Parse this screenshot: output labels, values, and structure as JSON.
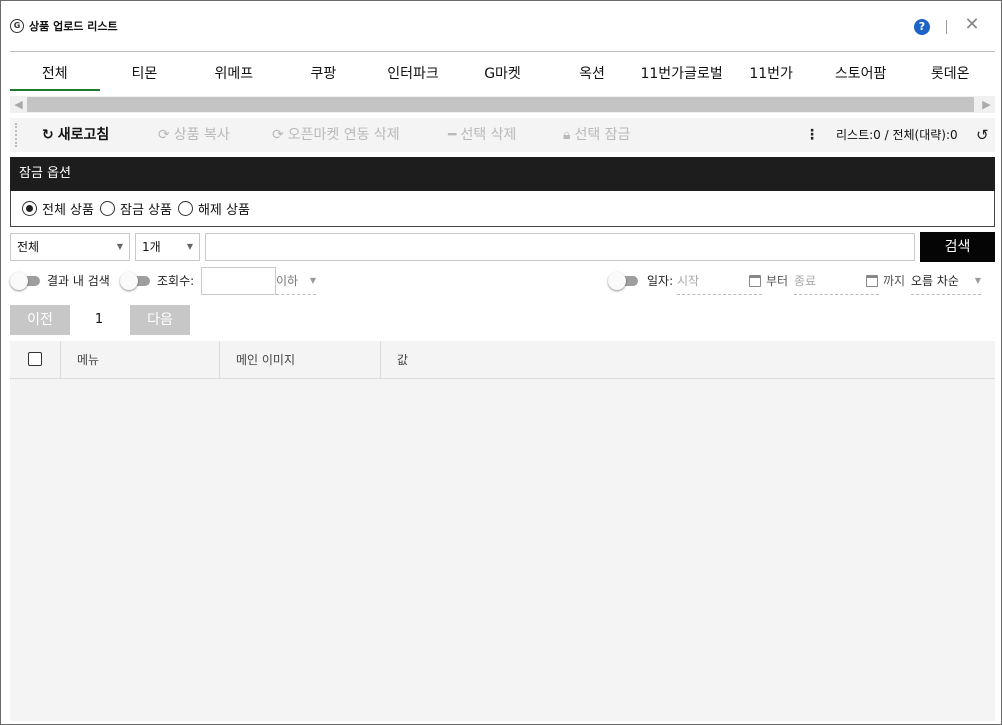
{
  "window": {
    "logo_text": "G",
    "title": "상품 업로드 리스트",
    "help_label": "?",
    "close_label": "✕"
  },
  "tabs": [
    {
      "label": "전체",
      "active": true
    },
    {
      "label": "티몬"
    },
    {
      "label": "위메프"
    },
    {
      "label": "쿠팡"
    },
    {
      "label": "인터파크"
    },
    {
      "label": "G마켓"
    },
    {
      "label": "옥션"
    },
    {
      "label": "11번가글로벌"
    },
    {
      "label": "11번가"
    },
    {
      "label": "스토어팜"
    },
    {
      "label": "롯데온"
    }
  ],
  "toolbar": {
    "refresh": "새로고침",
    "copy": "상품 복사",
    "delete_market": "오픈마켓 연동 삭제",
    "delete_selected": "선택 삭제",
    "lock_selected": "선택 잠금",
    "counts": "리스트:0  /  전체(대략):0"
  },
  "lock_options": {
    "title": "잠금 옵션",
    "choices": [
      "전체 상품",
      "잠금 상품",
      "해제 상품"
    ],
    "selected": 0
  },
  "search": {
    "type_value": "전체",
    "count_value": "1개",
    "query": "",
    "button": "검색"
  },
  "filters": {
    "in_results": "결과 내 검색",
    "views": "조회수:",
    "views_value": "",
    "under": "이하",
    "date": "일자:",
    "start_placeholder": "시작",
    "from": "부터",
    "end_placeholder": "종료",
    "until": "까지",
    "sort": "오름 차순"
  },
  "pager": {
    "prev": "이전",
    "page": "1",
    "next": "다음"
  },
  "table": {
    "columns": [
      "메뉴",
      "메인 이미지",
      "값"
    ]
  },
  "colors": {
    "tab_active": "#1e7a2e",
    "header_dark": "#1d1d1d",
    "search_button": "#050505",
    "help": "#1f63c6"
  }
}
